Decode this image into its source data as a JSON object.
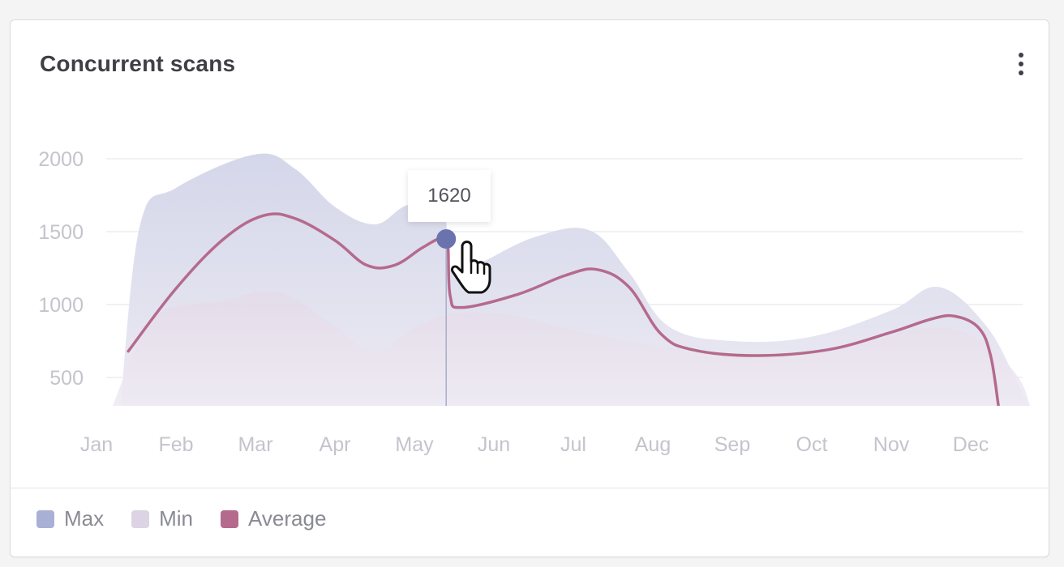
{
  "card": {
    "title": "Concurrent scans"
  },
  "tooltip": {
    "value": "1620"
  },
  "legend": [
    {
      "label": "Max",
      "color": "#a9b0d6"
    },
    {
      "label": "Min",
      "color": "#dcd4e4"
    },
    {
      "label": "Average",
      "color": "#b56a8d"
    }
  ],
  "colors": {
    "max_fill": "#dcdeee",
    "min_fill": "#e7e1ec",
    "average_line": "#b56a8d",
    "grid": "#f1f1f3",
    "axis_text": "#c4c4cc",
    "hover_marker": "#6a73ae",
    "hover_line": "#a9acc9"
  },
  "chart_data": {
    "type": "area",
    "categories": [
      "Jan",
      "Feb",
      "Mar",
      "Apr",
      "May",
      "Jun",
      "Jul",
      "Aug",
      "Sep",
      "Oct",
      "Nov",
      "Dec"
    ],
    "yticks": [
      500,
      1000,
      1500,
      2000
    ],
    "ylim": [
      300,
      2100
    ],
    "grid": true,
    "legend_position": "bottom-left",
    "series": [
      {
        "name": "Max",
        "points": [
          [
            0.3,
            300
          ],
          [
            0.55,
            1550
          ],
          [
            1.0,
            1800
          ],
          [
            2.0,
            2030
          ],
          [
            2.5,
            1930
          ],
          [
            3.0,
            1670
          ],
          [
            3.5,
            1550
          ],
          [
            3.9,
            1680
          ],
          [
            4.35,
            1700
          ],
          [
            4.45,
            1250
          ],
          [
            4.8,
            1280
          ],
          [
            5.5,
            1460
          ],
          [
            6.2,
            1510
          ],
          [
            6.7,
            1220
          ],
          [
            7.2,
            850
          ],
          [
            8.0,
            750
          ],
          [
            9.0,
            780
          ],
          [
            10.0,
            960
          ],
          [
            10.6,
            1120
          ],
          [
            11.2,
            850
          ],
          [
            11.6,
            450
          ],
          [
            11.75,
            300
          ]
        ]
      },
      {
        "name": "Min",
        "points": [
          [
            0.2,
            300
          ],
          [
            0.5,
            700
          ],
          [
            0.8,
            950
          ],
          [
            1.6,
            1030
          ],
          [
            2.1,
            1090
          ],
          [
            2.5,
            1040
          ],
          [
            3.0,
            850
          ],
          [
            3.5,
            680
          ],
          [
            4.0,
            840
          ],
          [
            4.5,
            940
          ],
          [
            5.2,
            930
          ],
          [
            5.8,
            850
          ],
          [
            6.5,
            770
          ],
          [
            7.5,
            680
          ],
          [
            8.5,
            660
          ],
          [
            9.5,
            720
          ],
          [
            10.3,
            830
          ],
          [
            10.8,
            830
          ],
          [
            11.2,
            730
          ],
          [
            11.6,
            500
          ],
          [
            11.75,
            300
          ]
        ]
      },
      {
        "name": "Average",
        "points": [
          [
            0.4,
            680
          ],
          [
            1.0,
            1110
          ],
          [
            1.6,
            1450
          ],
          [
            2.1,
            1610
          ],
          [
            2.5,
            1590
          ],
          [
            3.0,
            1440
          ],
          [
            3.4,
            1270
          ],
          [
            3.75,
            1270
          ],
          [
            4.1,
            1390
          ],
          [
            4.35,
            1460
          ],
          [
            4.42,
            1420
          ],
          [
            4.45,
            1060
          ],
          [
            4.6,
            980
          ],
          [
            5.3,
            1070
          ],
          [
            5.9,
            1200
          ],
          [
            6.3,
            1240
          ],
          [
            6.7,
            1120
          ],
          [
            7.1,
            800
          ],
          [
            7.5,
            690
          ],
          [
            8.3,
            650
          ],
          [
            9.2,
            690
          ],
          [
            10.0,
            810
          ],
          [
            10.5,
            900
          ],
          [
            10.8,
            920
          ],
          [
            11.1,
            840
          ],
          [
            11.25,
            650
          ],
          [
            11.35,
            300
          ]
        ]
      }
    ],
    "hover": {
      "x": 4.4,
      "y": 1450,
      "label": "1620"
    }
  }
}
